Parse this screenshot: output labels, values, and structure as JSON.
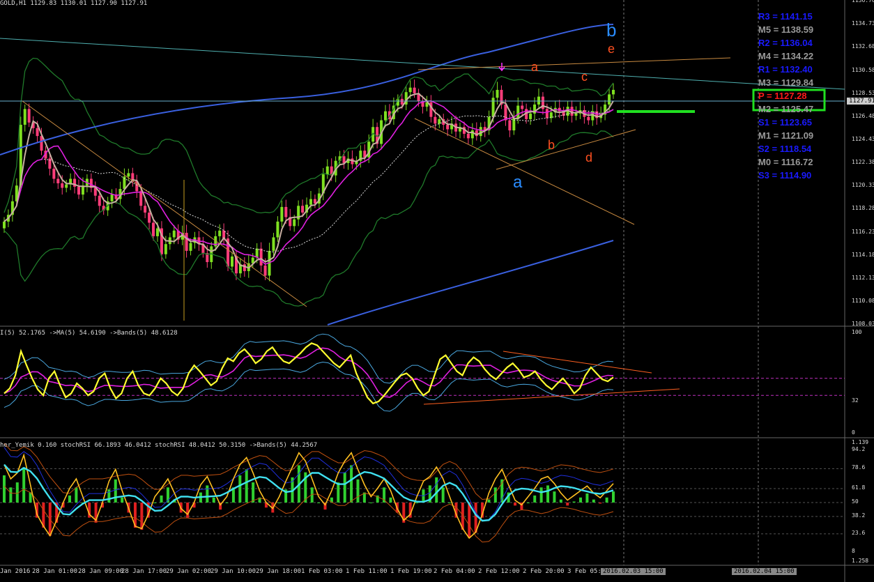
{
  "header": {
    "symbol_info": "GOLD,H1  1129.83 1130.01 1127.90 1127.91"
  },
  "price_axis": [
    "1136.76",
    "1134.73",
    "1132.68",
    "1130.58",
    "1128.53",
    "1126.48",
    "1124.43",
    "1122.38",
    "1120.33",
    "1118.28",
    "1116.23",
    "1114.18",
    "1112.13",
    "1110.08",
    "1108.03"
  ],
  "current_price_tag": "1127.91",
  "pivots": [
    {
      "label": "R3 = 1141.15",
      "color": "#1a1aff"
    },
    {
      "label": "M5 = 1138.59",
      "color": "#9a9a9a"
    },
    {
      "label": "R2 = 1136.04",
      "color": "#1a1aff"
    },
    {
      "label": "M4 = 1134.22",
      "color": "#9a9a9a"
    },
    {
      "label": "R1 = 1132.40",
      "color": "#1a1aff"
    },
    {
      "label": "M3 = 1129.84",
      "color": "#9a9a9a"
    },
    {
      "label": "P  = 1127.28",
      "color": "#ff1a1a"
    },
    {
      "label": "M2 = 1125.47",
      "color": "#9a9a9a"
    },
    {
      "label": "S1 = 1123.65",
      "color": "#1a1aff"
    },
    {
      "label": "M1 = 1121.09",
      "color": "#9a9a9a"
    },
    {
      "label": "S2 = 1118.54",
      "color": "#1a1aff"
    },
    {
      "label": "M0 = 1116.72",
      "color": "#9a9a9a"
    },
    {
      "label": "S3 = 1114.90",
      "color": "#1a1aff"
    }
  ],
  "wave_labels": [
    {
      "text": "b",
      "color": "#2a8cff"
    },
    {
      "text": "e",
      "color": "#ff5020"
    },
    {
      "text": "a",
      "color": "#ff5020"
    },
    {
      "text": "c",
      "color": "#ff5020"
    },
    {
      "text": "b",
      "color": "#ff5020"
    },
    {
      "text": "d",
      "color": "#ff5020"
    },
    {
      "text": "a",
      "color": "#2a8cff"
    }
  ],
  "rsi_pane": {
    "header": "I(5) 52.1765  ->MA(5) 54.6190  ->Bands(5) 48.6128",
    "axis": [
      "100",
      "32",
      "0"
    ]
  },
  "stoch_pane": {
    "header": "her_Yemik 0.160  stochRSI 66.1893 46.0412  stochRSI 48.0412 50.3150  ->Bands(5) 44.2567",
    "axis": [
      "1.139",
      "94.2",
      "78.6",
      "61.8",
      "50",
      "38.2",
      "23.6",
      "8",
      "1.258"
    ]
  },
  "time_axis": [
    "Jan 2016",
    "28 Jan 01:00",
    "28 Jan 09:00",
    "28 Jan 17:00",
    "29 Jan 02:00",
    "29 Jan 10:00",
    "29 Jan 18:00",
    "1 Feb 03:00",
    "1 Feb 11:00",
    "1 Feb 19:00",
    "2 Feb 04:00",
    "2 Feb 12:00",
    "2 Feb 20:00",
    "3 Feb 05:00"
  ],
  "time_tags": [
    "2016.02.03 15:00",
    "2016.02.04 15:00"
  ],
  "chart_data": {
    "type": "candlestick",
    "symbol": "GOLD",
    "timeframe": "H1",
    "ylim": [
      1108.03,
      1136.76
    ],
    "candles_close": [
      1117.2,
      1117.8,
      1119.0,
      1120.4,
      1125.8,
      1127.2,
      1126.0,
      1125.5,
      1124.8,
      1123.5,
      1122.8,
      1121.9,
      1121.0,
      1120.6,
      1120.2,
      1120.5,
      1121.0,
      1120.3,
      1119.6,
      1120.4,
      1121.0,
      1120.2,
      1119.5,
      1118.6,
      1118.2,
      1119.0,
      1119.6,
      1119.2,
      1120.1,
      1121.2,
      1121.5,
      1120.8,
      1119.9,
      1118.6,
      1118.0,
      1117.1,
      1115.9,
      1116.6,
      1114.3,
      1115.2,
      1115.8,
      1116.4,
      1115.6,
      1116.2,
      1114.6,
      1115.3,
      1115.8,
      1115.2,
      1114.4,
      1113.6,
      1115.0,
      1115.9,
      1116.4,
      1115.7,
      1113.2,
      1114.1,
      1112.6,
      1113.4,
      1112.8,
      1113.5,
      1114.0,
      1114.8,
      1113.3,
      1112.4,
      1114.6,
      1115.8,
      1117.2,
      1118.5,
      1117.6,
      1116.8,
      1117.4,
      1118.6,
      1118.0,
      1118.7,
      1119.2,
      1118.8,
      1119.7,
      1121.4,
      1122.1,
      1121.3,
      1122.6,
      1123.0,
      1122.4,
      1122.8,
      1122.3,
      1122.6,
      1123.5,
      1122.9,
      1124.3,
      1125.6,
      1124.1,
      1126.2,
      1127.0,
      1126.3,
      1127.5,
      1128.1,
      1127.6,
      1128.7,
      1129.1,
      1128.6,
      1127.9,
      1127.4,
      1127.8,
      1126.5,
      1125.9,
      1126.3,
      1125.8,
      1125.4,
      1125.9,
      1125.2,
      1125.6,
      1125.0,
      1124.6,
      1125.3,
      1124.8,
      1125.6,
      1125.3,
      1126.5,
      1128.2,
      1128.9,
      1127.6,
      1126.2,
      1125.3,
      1126.4,
      1127.5,
      1127.2,
      1126.3,
      1126.8,
      1127.6,
      1128.3,
      1127.2,
      1126.4,
      1126.9,
      1127.3,
      1127.0,
      1126.6,
      1127.4,
      1126.6,
      1126.8,
      1127.1,
      1126.5,
      1126.2,
      1127.0,
      1126.4,
      1126.7,
      1127.6,
      1128.5,
      1128.9
    ],
    "pivot_levels": [
      {
        "name": "R3",
        "value": 1141.15
      },
      {
        "name": "M5",
        "value": 1138.59
      },
      {
        "name": "R2",
        "value": 1136.04
      },
      {
        "name": "M4",
        "value": 1134.22
      },
      {
        "name": "R1",
        "value": 1132.4
      },
      {
        "name": "M3",
        "value": 1129.84
      },
      {
        "name": "P",
        "value": 1127.28
      },
      {
        "name": "M2",
        "value": 1125.47
      },
      {
        "name": "S1",
        "value": 1123.65
      },
      {
        "name": "M1",
        "value": 1121.09
      },
      {
        "name": "S2",
        "value": 1118.54
      },
      {
        "name": "M0",
        "value": 1116.72
      },
      {
        "name": "S3",
        "value": 1114.9
      }
    ],
    "rsi_series": [
      40,
      45,
      58,
      82,
      68,
      55,
      44,
      38,
      55,
      62,
      48,
      36,
      40,
      50,
      45,
      38,
      42,
      55,
      60,
      45,
      35,
      40,
      55,
      62,
      48,
      40,
      38,
      45,
      55,
      50,
      42,
      38,
      45,
      60,
      68,
      62,
      55,
      48,
      52,
      65,
      75,
      72,
      80,
      84,
      78,
      70,
      74,
      82,
      86,
      78,
      72,
      70,
      75,
      80,
      86,
      90,
      88,
      82,
      76,
      70,
      66,
      72,
      78,
      60,
      48,
      36,
      30,
      32,
      38,
      45,
      52,
      58,
      60,
      55,
      45,
      38,
      42,
      58,
      74,
      78,
      70,
      62,
      58,
      70,
      76,
      72,
      64,
      58,
      54,
      60,
      66,
      70,
      64,
      56,
      58,
      62,
      54,
      48,
      44,
      50,
      55,
      48,
      40,
      45,
      58,
      66,
      60,
      54,
      52,
      56
    ],
    "stoch_signal": [
      82,
      70,
      75,
      90,
      65,
      40,
      30,
      22,
      35,
      50,
      62,
      70,
      55,
      40,
      35,
      50,
      68,
      78,
      60,
      45,
      30,
      28,
      40,
      55,
      62,
      70,
      58,
      45,
      40,
      50,
      65,
      72,
      60,
      48,
      55,
      70,
      82,
      88,
      75,
      60,
      50,
      45,
      55,
      68,
      80,
      92,
      85,
      70,
      55,
      48,
      60,
      75,
      85,
      92,
      78,
      65,
      55,
      62,
      70,
      60,
      45,
      35,
      40,
      55,
      68,
      72,
      80,
      70,
      55,
      40,
      28,
      20,
      25,
      40,
      58,
      70,
      78,
      65,
      52,
      48,
      55,
      62,
      70,
      72,
      66,
      58,
      52,
      56,
      60,
      64,
      58,
      54,
      60,
      66
    ]
  }
}
